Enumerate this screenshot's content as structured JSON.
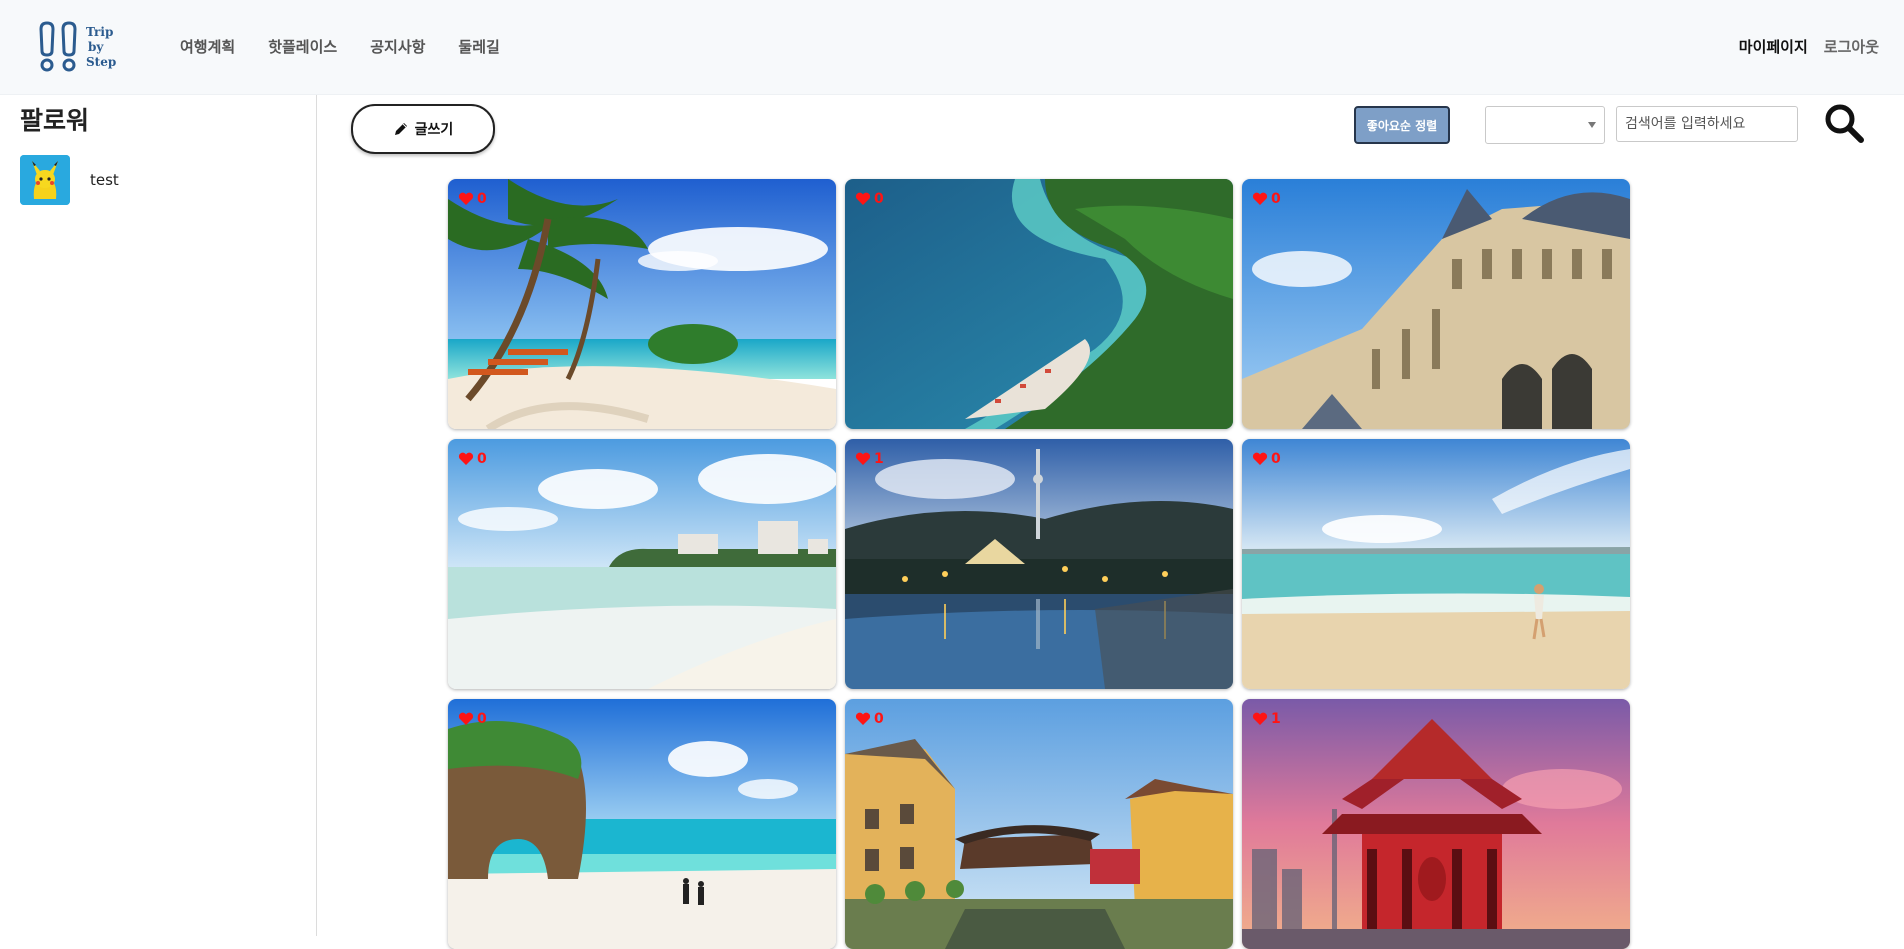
{
  "logo": {
    "line1": "Trip",
    "line2": "by",
    "line3": "Step"
  },
  "nav": {
    "items": [
      "여행계획",
      "핫플레이스",
      "공지사항",
      "둘레길"
    ],
    "mypage": "마이페이지",
    "logout": "로그아웃"
  },
  "sidebar": {
    "title": "팔로워",
    "followers": [
      {
        "name": "test"
      }
    ]
  },
  "toolbar": {
    "write_label": "글쓰기",
    "sort_label": "좋아요순 정렬",
    "select_value": "",
    "search_placeholder": "검색어를 입력하세요"
  },
  "posts": [
    {
      "likes": "0",
      "scene": "tropical beach with palm trees"
    },
    {
      "likes": "0",
      "scene": "aerial coastline with turquoise sea"
    },
    {
      "likes": "0",
      "scene": "Louvre palace facade"
    },
    {
      "likes": "0",
      "scene": "white sand beach with hotels"
    },
    {
      "likes": "1",
      "scene": "night lake with lit castle and tower"
    },
    {
      "likes": "0",
      "scene": "woman walking on beach"
    },
    {
      "likes": "0",
      "scene": "rock arch on tropical beach"
    },
    {
      "likes": "0",
      "scene": "Hoi An Japanese covered bridge"
    },
    {
      "likes": "1",
      "scene": "Sensoji Kaminarimon red gate at sunset"
    }
  ],
  "colors": {
    "like": "#ff1414",
    "sort_button": "#7e9fc7",
    "header_bg": "#f7f9fb"
  }
}
